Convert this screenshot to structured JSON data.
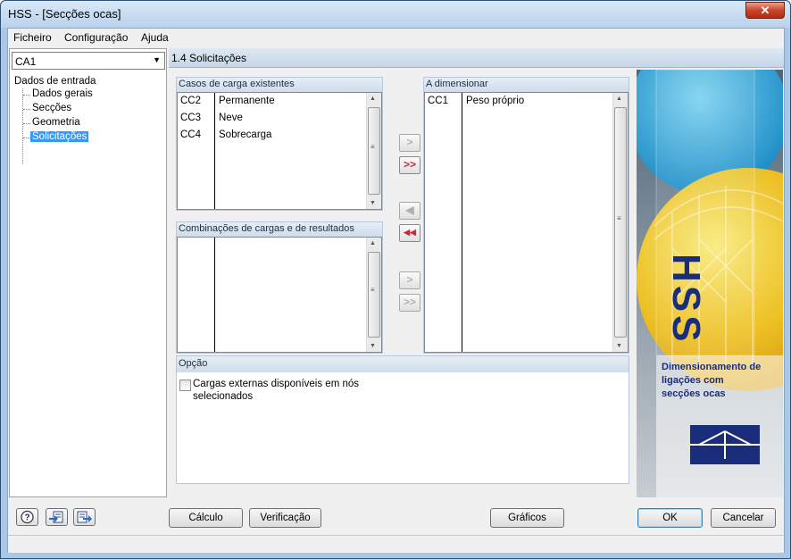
{
  "window": {
    "title": "HSS - [Secções ocas]",
    "close_label": "✕"
  },
  "menu": {
    "items": [
      "Ficheiro",
      "Configuração",
      "Ajuda"
    ]
  },
  "sidebar": {
    "combo_value": "CA1",
    "tree_root": "Dados de entrada",
    "items": [
      "Dados gerais",
      "Secções",
      "Geometria",
      "Solicitações"
    ],
    "selected": "Solicitações"
  },
  "section": {
    "title": "1.4 Solicitações"
  },
  "existing_cases": {
    "title": "Casos de carga  existentes",
    "rows": [
      {
        "id": "CC2",
        "name": "Permanente"
      },
      {
        "id": "CC3",
        "name": "Neve"
      },
      {
        "id": "CC4",
        "name": "Sobrecarga"
      }
    ]
  },
  "combinations": {
    "title": "Combinações de cargas e de resultados",
    "rows": []
  },
  "to_design": {
    "title": "A dimensionar",
    "rows": [
      {
        "id": "CC1",
        "name": "Peso próprio"
      }
    ]
  },
  "transfer_buttons": {
    "add_one": ">",
    "add_all": ">>",
    "remove_one": "◀",
    "remove_all": "◀◀",
    "add_one_combo": ">",
    "add_all_combo": ">>"
  },
  "option": {
    "title": "Opção",
    "checkbox_label": "Cargas externas disponíveis em nós selecionados",
    "checked": false
  },
  "side_image": {
    "logo_text": "HSS",
    "caption": "Dimensionamento de ligações com secções ocas"
  },
  "buttons": {
    "calculation": "Cálculo",
    "verification": "Verificação",
    "graphics": "Gráficos",
    "ok": "OK",
    "cancel": "Cancelar"
  },
  "icon_buttons": [
    "help-icon",
    "import-icon",
    "export-icon"
  ],
  "colors": {
    "accent": "#3399ff",
    "transfer_active": "#c8283c",
    "logo_navy": "#1a2d7a"
  }
}
